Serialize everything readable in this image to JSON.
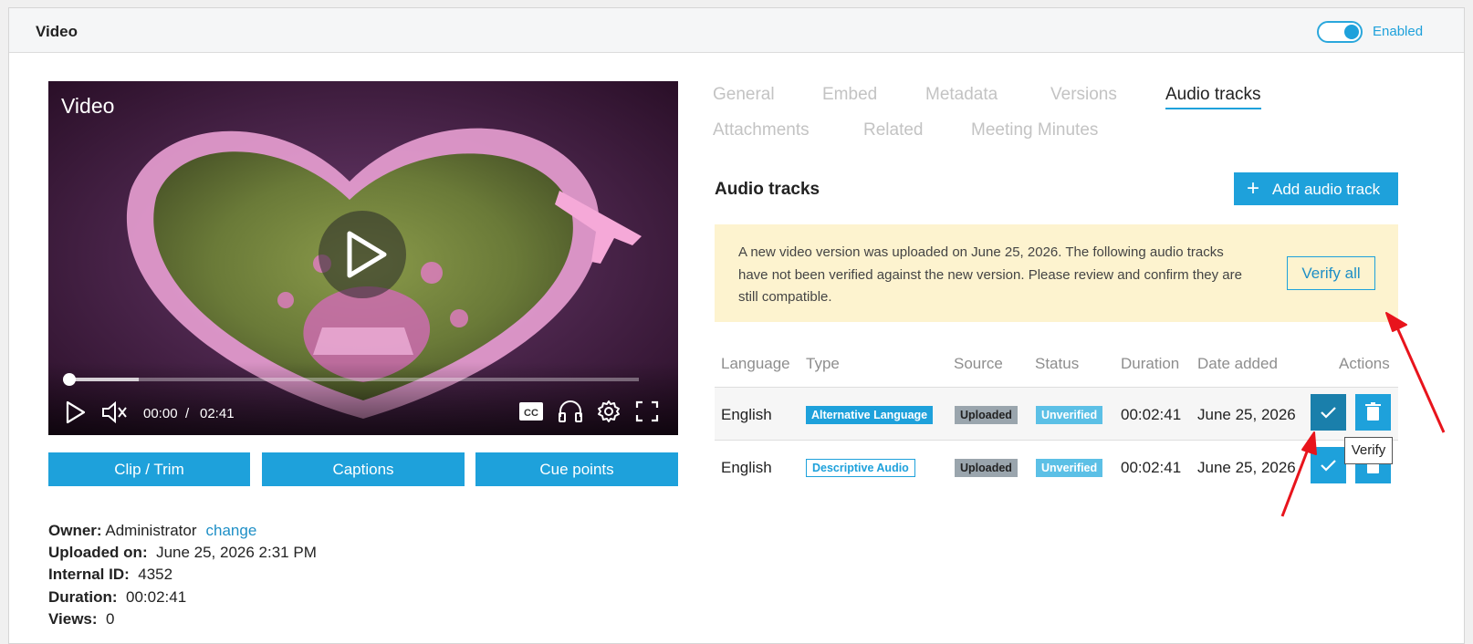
{
  "panel": {
    "title": "Video",
    "toggle_label": "Enabled"
  },
  "video": {
    "title": "Video",
    "current_time": "00:00",
    "separator": "/",
    "duration": "02:41",
    "progress": 0.0
  },
  "video_buttons": [
    "Clip / Trim",
    "Captions",
    "Cue points"
  ],
  "meta": {
    "owner_label": "Owner:",
    "owner": "Administrator",
    "change_link": "change",
    "uploaded_label": "Uploaded on:",
    "uploaded": "June 25, 2026 2:31 PM",
    "id_label": "Internal ID:",
    "id": "4352",
    "duration_label": "Duration:",
    "duration": "00:02:41",
    "views_label": "Views:",
    "views": "0"
  },
  "tabs": [
    "General",
    "Embed",
    "Metadata",
    "Versions",
    "Audio tracks",
    "Attachments",
    "Related",
    "Meeting Minutes"
  ],
  "active_tab": "Audio tracks",
  "audio": {
    "title": "Audio tracks",
    "add_button": "Add audio track",
    "notice": "A new video version was uploaded on June 25, 2026. The following audio tracks have not been verified against the new version. Please review and confirm they are still compatible.",
    "verify_all": "Verify all",
    "columns": [
      "Language",
      "Type",
      "Source",
      "Status",
      "Duration",
      "Date added",
      "Actions"
    ],
    "rows": [
      {
        "language": "English",
        "type": "Alternative Language",
        "source": "Uploaded",
        "status": "Unverified",
        "duration": "00:02:41",
        "date": "June 25, 2026"
      },
      {
        "language": "English",
        "type": "Descriptive Audio",
        "source": "Uploaded",
        "status": "Unverified",
        "duration": "00:02:41",
        "date": "June 25, 2026"
      }
    ],
    "tooltip": "Verify"
  },
  "colors": {
    "accent": "#1ea1db",
    "notice_bg": "#fdf3cf",
    "annotation": "#e8141c"
  },
  "icons": [
    "play-icon",
    "volume-icon",
    "captions-icon",
    "audio-tracks-icon",
    "settings-icon",
    "fullscreen-icon",
    "plus-icon",
    "check-icon",
    "trash-icon"
  ]
}
